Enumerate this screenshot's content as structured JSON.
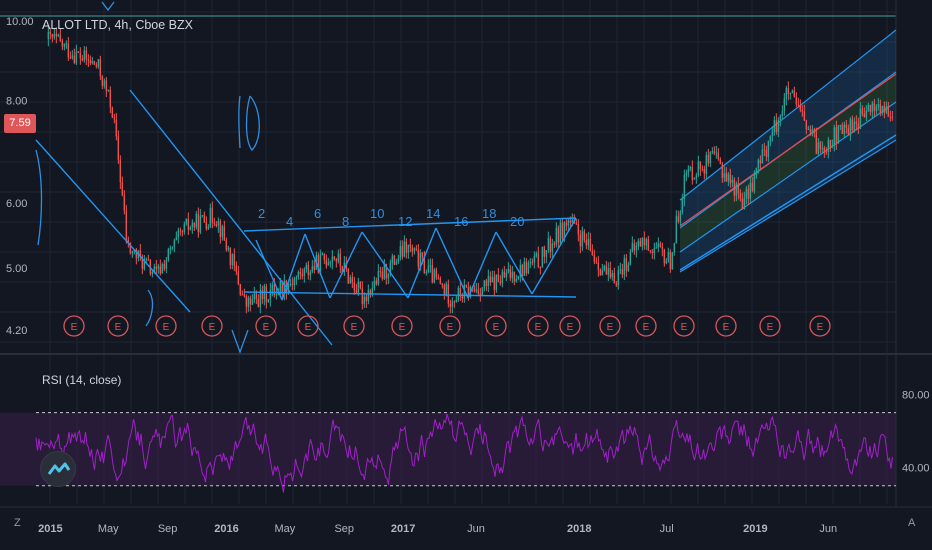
{
  "header": {
    "title": "ALLOT LTD, 4h, Cboe BZX"
  },
  "price_badge": "7.59",
  "rsi_panel": {
    "title": "RSI (14, close)"
  },
  "corner": {
    "left": "Z",
    "right": "A"
  },
  "colors": {
    "background": "#131722",
    "grid": "#1e2433",
    "up_candle": "#26a69a",
    "down_candle": "#ef5350",
    "trendline": "#2196f3",
    "regression_center": "#e84a4a",
    "rsi_line": "#a020c8",
    "rsi_band": "#3a1f4a",
    "event_marker": "#d9575a"
  },
  "chart_data": [
    {
      "type": "candlestick",
      "title": "ALLOT LTD, 4h, Cboe BZX",
      "x_ticks": [
        "2015",
        "May",
        "Sep",
        "2016",
        "May",
        "Sep",
        "2017",
        "Jun",
        "2018",
        "Jul",
        "2019",
        "Jun"
      ],
      "y_ticks": [
        "10.00",
        "8.00",
        "6.00",
        "5.00",
        "4.20"
      ],
      "scale": "log",
      "last_price": "7.59",
      "event_markers": [
        "E",
        "E",
        "E",
        "E",
        "E",
        "E",
        "E",
        "E",
        "E",
        "E",
        "E",
        "E",
        "E",
        "E",
        "E",
        "E",
        "E",
        "E"
      ],
      "approx_path": [
        {
          "x": "2015-01",
          "y": 9.5
        },
        {
          "x": "2015-02",
          "y": 9.2
        },
        {
          "x": "2015-04",
          "y": 8.8
        },
        {
          "x": "2015-05",
          "y": 7.8
        },
        {
          "x": "2015-06",
          "y": 5.3
        },
        {
          "x": "2015-08",
          "y": 4.9
        },
        {
          "x": "2015-10",
          "y": 5.6
        },
        {
          "x": "2015-12",
          "y": 5.8
        },
        {
          "x": "2016-02",
          "y": 4.5
        },
        {
          "x": "2016-05",
          "y": 4.8
        },
        {
          "x": "2016-08",
          "y": 5.2
        },
        {
          "x": "2016-10",
          "y": 4.6
        },
        {
          "x": "2017-01",
          "y": 5.3
        },
        {
          "x": "2017-04",
          "y": 4.6
        },
        {
          "x": "2017-07",
          "y": 4.8
        },
        {
          "x": "2017-10",
          "y": 5.1
        },
        {
          "x": "2017-12",
          "y": 5.7
        },
        {
          "x": "2018-03",
          "y": 4.8
        },
        {
          "x": "2018-05",
          "y": 5.4
        },
        {
          "x": "2018-07",
          "y": 5.1
        },
        {
          "x": "2018-08",
          "y": 6.5
        },
        {
          "x": "2018-10",
          "y": 6.8
        },
        {
          "x": "2018-12",
          "y": 6.0
        },
        {
          "x": "2019-02",
          "y": 7.4
        },
        {
          "x": "2019-03",
          "y": 8.2
        },
        {
          "x": "2019-05",
          "y": 7.0
        },
        {
          "x": "2019-07",
          "y": 7.4
        },
        {
          "x": "2019-09",
          "y": 7.9
        },
        {
          "x": "2019-10",
          "y": 7.6
        }
      ]
    },
    {
      "type": "line",
      "title": "RSI (14, close)",
      "y_ticks": [
        "80.00",
        "40.00"
      ],
      "bands": [
        30,
        70
      ],
      "approx_range": [
        20,
        90
      ]
    }
  ]
}
